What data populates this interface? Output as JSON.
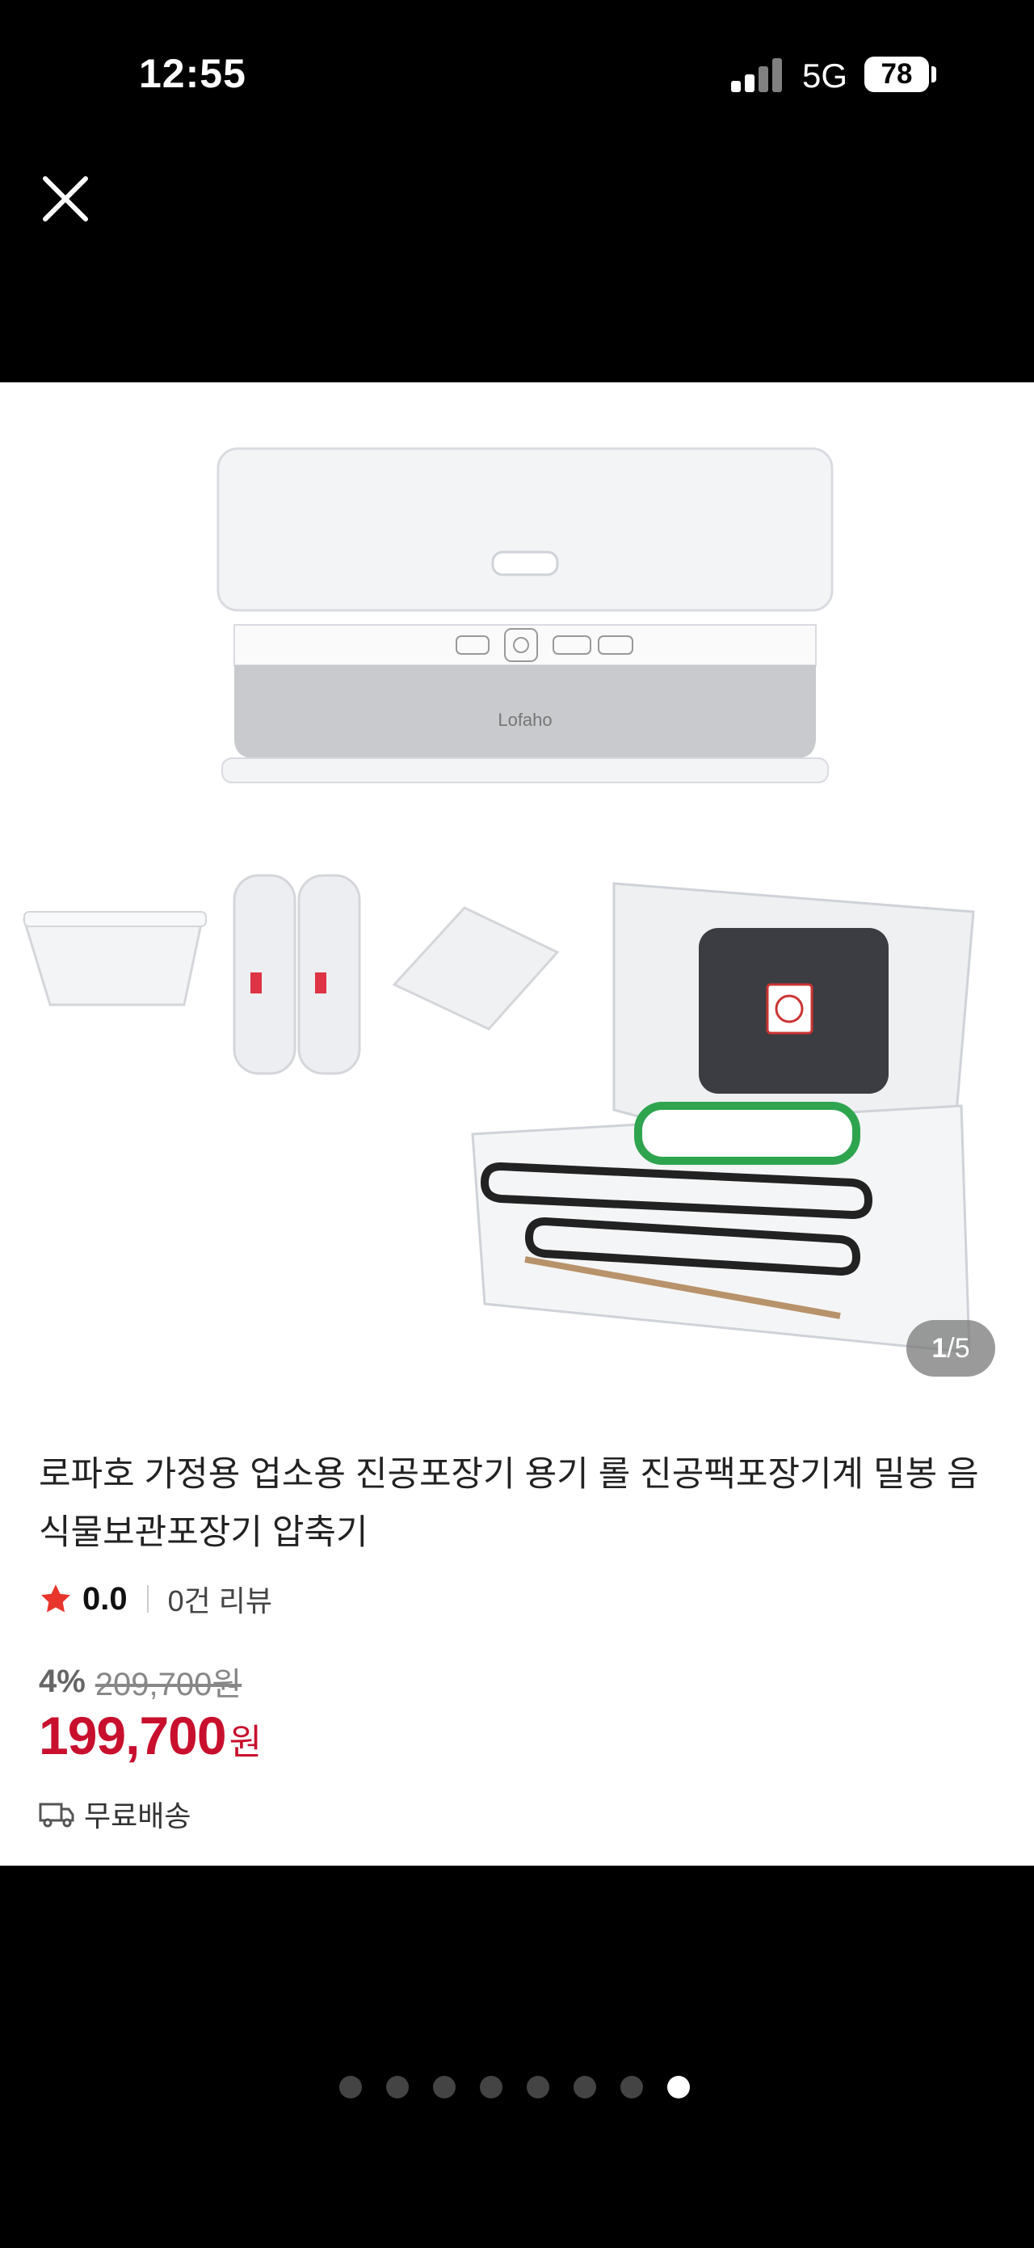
{
  "status_bar": {
    "time": "12:55",
    "network": "5G",
    "battery": "78"
  },
  "icons": {
    "close": "close-icon",
    "star": "star-icon",
    "shipping": "truck-icon"
  },
  "product": {
    "title": "로파호 가정용 업소용 진공포장기 용기 롤 진공팩포장기계 밀봉 음식물보관포장기 압축기",
    "image_counter": {
      "current": "1",
      "separator": "/",
      "total": "5"
    },
    "rating": "0.0",
    "review_count": "0건 리뷰",
    "discount": "4%",
    "original_price": "209,700원",
    "price": "199,700",
    "currency": "원",
    "shipping": "무료배송",
    "brand_on_image": "Lofaho"
  },
  "pager": {
    "count": 8,
    "active_index": 7
  },
  "colors": {
    "price": "#c8102e",
    "star": "#e8362d",
    "background": "#000000"
  }
}
